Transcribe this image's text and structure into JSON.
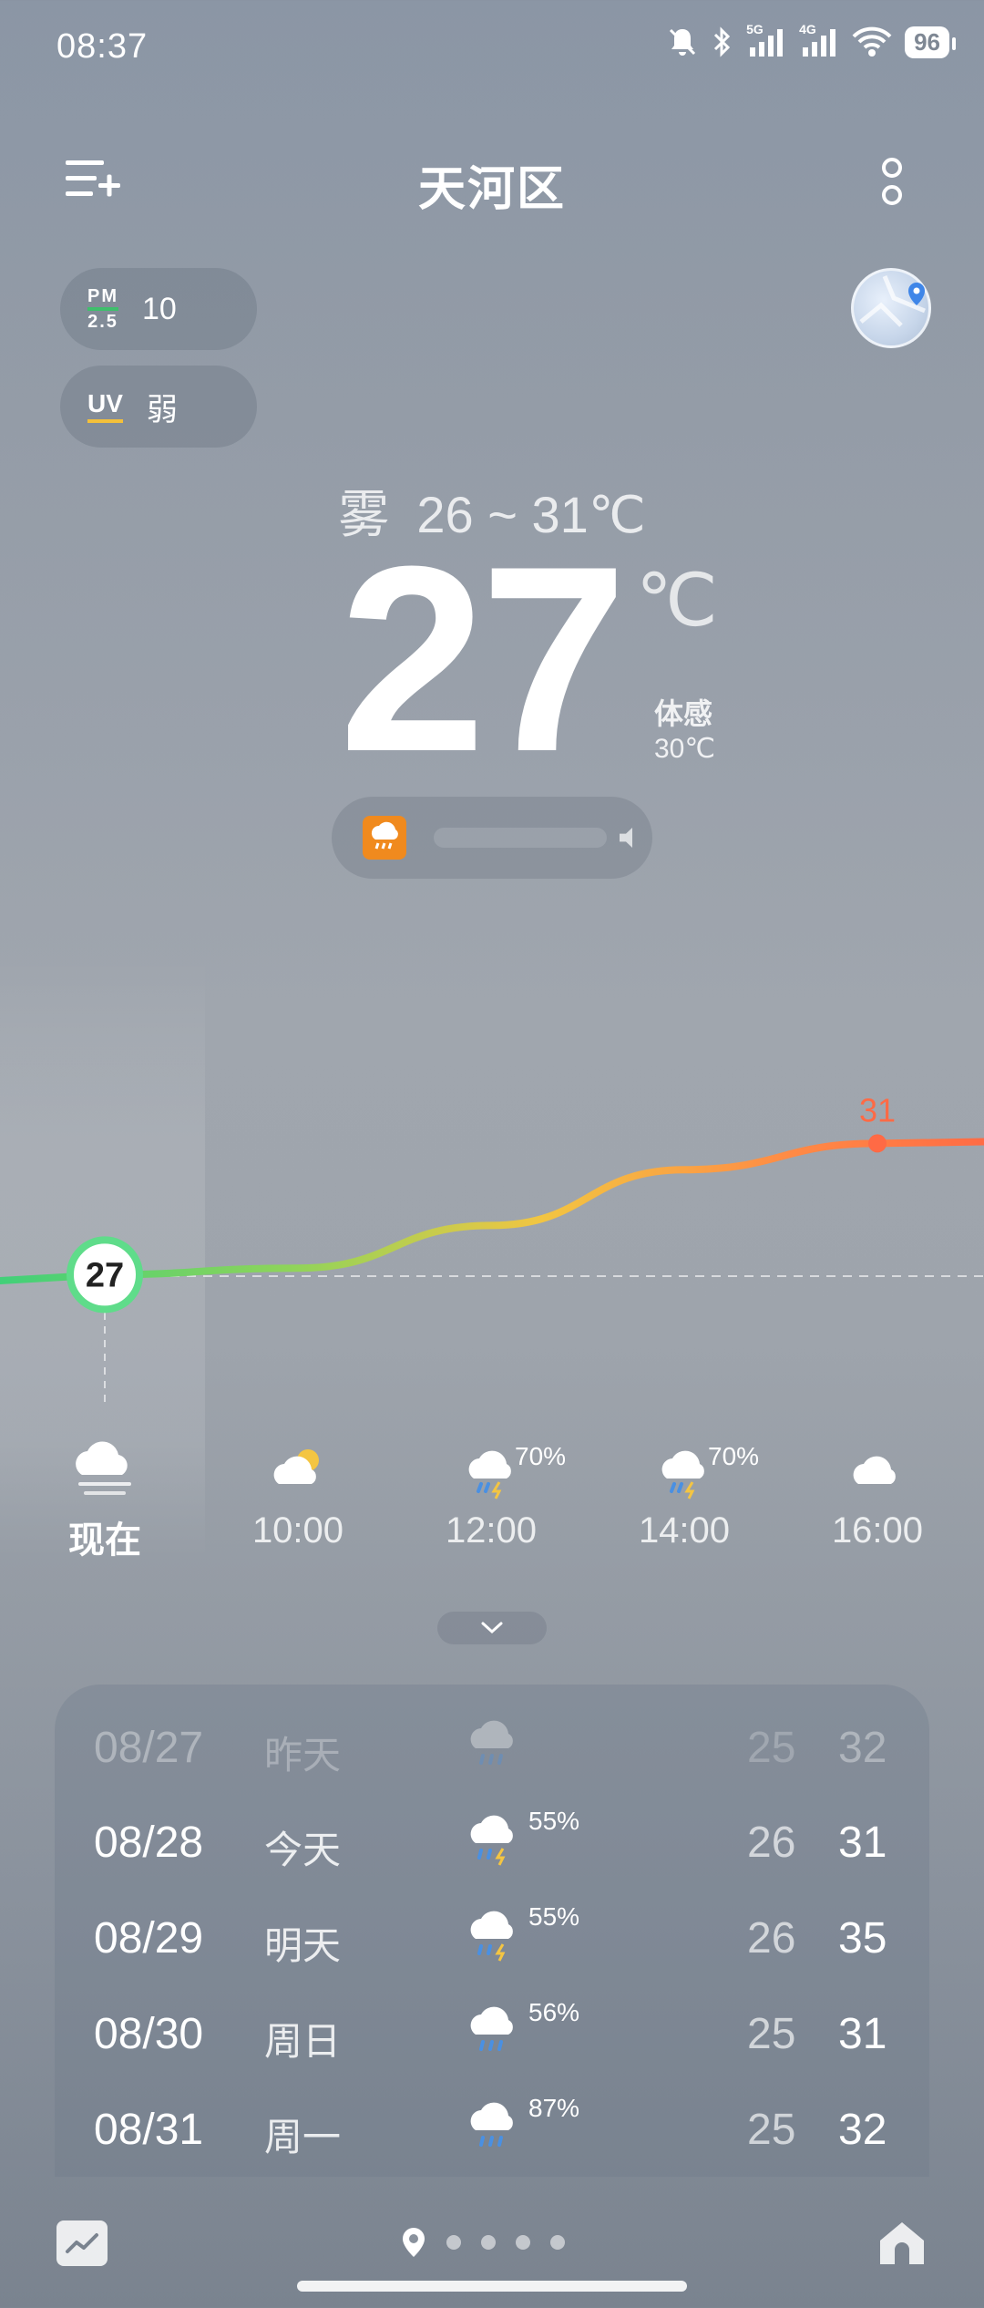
{
  "status_bar": {
    "time": "08:37",
    "network_5g": "5G",
    "network_4g": "4G",
    "battery": "96"
  },
  "header": {
    "title": "天河区"
  },
  "quick_info": {
    "pm_label_top": "PM",
    "pm_label_bottom": "2.5",
    "pm_value": "10",
    "uv_label": "UV",
    "uv_value": "弱"
  },
  "current": {
    "condition": "雾",
    "range": "26 ~ 31℃",
    "temperature": "27",
    "unit": "℃",
    "feels_label": "体感",
    "feels_value": "30℃"
  },
  "chart_data": {
    "type": "line",
    "x": [
      "现在",
      "10:00",
      "12:00",
      "14:00",
      "16:00"
    ],
    "values": [
      27,
      27.2,
      28.5,
      30.2,
      31
    ],
    "start_marker": "27",
    "max_label": "31"
  },
  "hourly": [
    {
      "label": "现在",
      "icon": "fog-cloud-icon",
      "pct": ""
    },
    {
      "label": "10:00",
      "icon": "partly-sunny-icon",
      "pct": ""
    },
    {
      "label": "12:00",
      "icon": "thunder-rain-icon",
      "pct": "70%"
    },
    {
      "label": "14:00",
      "icon": "thunder-rain-icon",
      "pct": "70%"
    },
    {
      "label": "16:00",
      "icon": "cloud-icon",
      "pct": ""
    }
  ],
  "daily": [
    {
      "date": "08/27",
      "name": "昨天",
      "icon": "rain-cloud-icon",
      "pct": "",
      "low": "25",
      "high": "32"
    },
    {
      "date": "08/28",
      "name": "今天",
      "icon": "thunder-rain-icon",
      "pct": "55%",
      "low": "26",
      "high": "31"
    },
    {
      "date": "08/29",
      "name": "明天",
      "icon": "thunder-rain-icon",
      "pct": "55%",
      "low": "26",
      "high": "35"
    },
    {
      "date": "08/30",
      "name": "周日",
      "icon": "rain-cloud-icon",
      "pct": "56%",
      "low": "25",
      "high": "31"
    },
    {
      "date": "08/31",
      "name": "周一",
      "icon": "rain-cloud-icon",
      "pct": "87%",
      "low": "25",
      "high": "32"
    }
  ],
  "colors": {
    "curve_cool": "#3fd07a",
    "curve_warm": "#ff6a45",
    "alert": "#f08a1e"
  }
}
